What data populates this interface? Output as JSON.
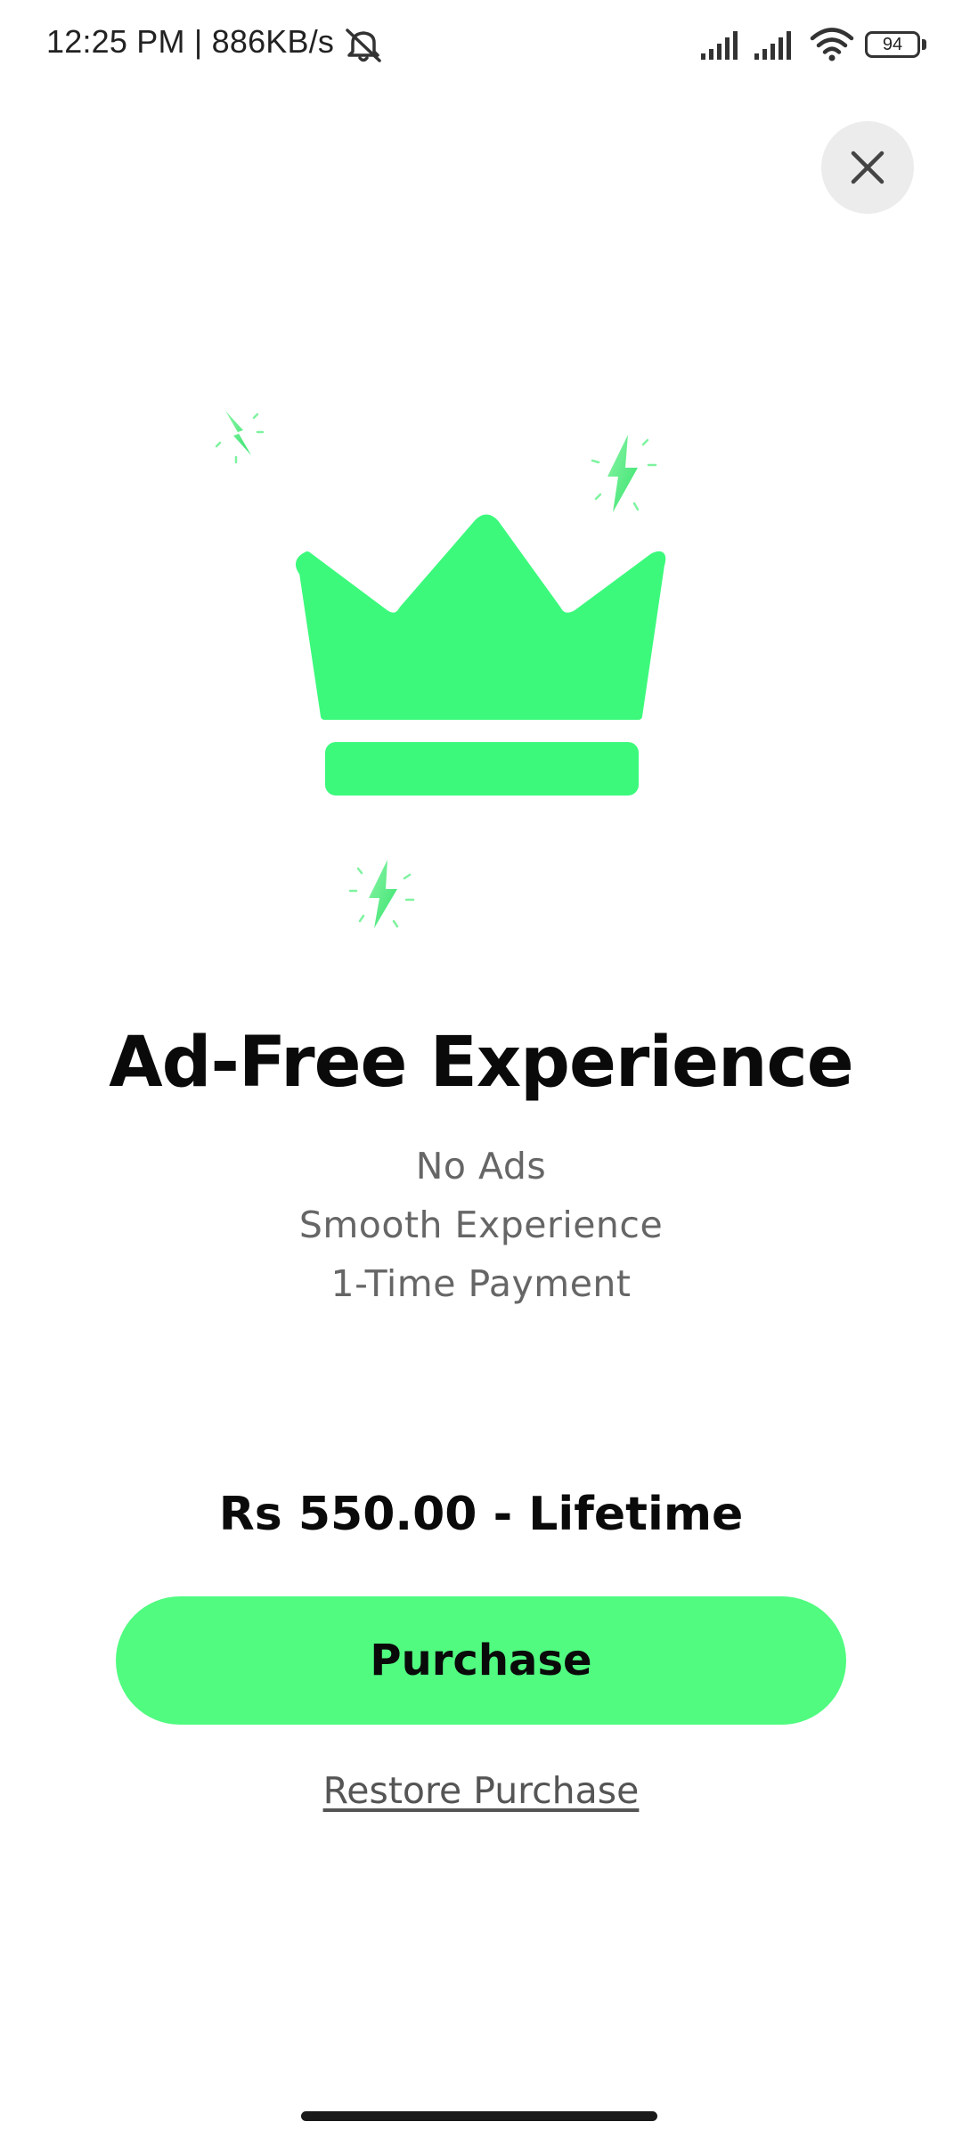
{
  "status_bar": {
    "time_speed": "12:25 PM | 886KB/s",
    "battery_level": "94",
    "icons": [
      "dnd-off-icon",
      "signal-icon",
      "signal-icon",
      "wifi-icon",
      "battery-icon"
    ]
  },
  "close_button": {
    "icon": "close-icon"
  },
  "illustration": {
    "icons": [
      "crown-icon",
      "lightning-icon",
      "lightning-icon",
      "lightning-icon"
    ],
    "accent_color": "#3cf97c"
  },
  "main": {
    "title": "Ad-Free Experience",
    "features": [
      "No Ads",
      "Smooth Experience",
      "1-Time Payment"
    ],
    "price": "Rs 550.00 - Lifetime",
    "purchase_label": "Purchase",
    "restore_label": "Restore Purchase"
  },
  "colors": {
    "button": "#50fb80",
    "text_primary": "#0a0a0a",
    "text_secondary": "#666666"
  }
}
